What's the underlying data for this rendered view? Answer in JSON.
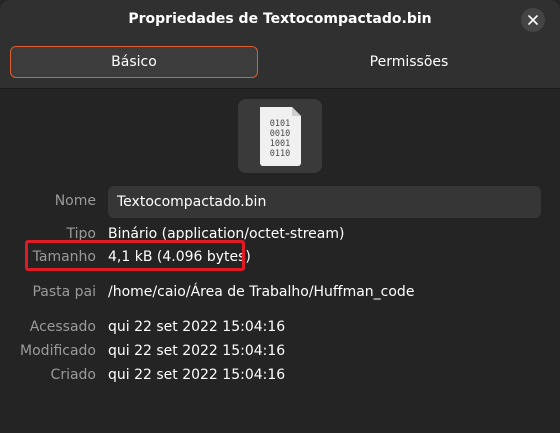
{
  "window": {
    "title": "Propriedades de Textocompactado.bin",
    "close_icon": "close-icon"
  },
  "tabs": [
    {
      "label": "Básico",
      "selected": true
    },
    {
      "label": "Permissões",
      "selected": false
    }
  ],
  "file_icon": {
    "icon": "binary-file-icon",
    "bits": [
      "0101",
      "0010",
      "1001",
      "0110"
    ]
  },
  "properties": {
    "name": {
      "label": "Nome",
      "value": "Textocompactado.bin"
    },
    "type": {
      "label": "Tipo",
      "value": "Binário (application/octet-stream)"
    },
    "size": {
      "label": "Tamanho",
      "value": "4,1 kB (4.096 bytes)"
    },
    "parent": {
      "label": "Pasta pai",
      "value": "/home/caio/Área de Trabalho/Huffman_code"
    },
    "accessed": {
      "label": "Acessado",
      "value": "qui 22 set 2022 15:04:16"
    },
    "modified": {
      "label": "Modificado",
      "value": "qui 22 set 2022 15:04:16"
    },
    "created": {
      "label": "Criado",
      "value": "qui 22 set 2022 15:04:16"
    }
  },
  "colors": {
    "accent": "#e05d2c",
    "highlight": "#e01b24",
    "background": "#242424"
  }
}
